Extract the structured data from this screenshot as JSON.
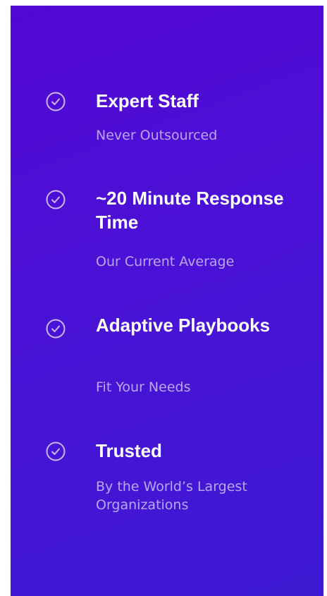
{
  "features": [
    {
      "icon": "check-circle-icon",
      "title": "Expert Staff",
      "subtitle": "Never Outsourced"
    },
    {
      "icon": "check-circle-icon",
      "title": "~20 Minute Response Time",
      "subtitle": "Our Current Average"
    },
    {
      "icon": "check-circle-icon",
      "title": "Adaptive Playbooks",
      "subtitle": "Fit Your Needs"
    },
    {
      "icon": "check-circle-icon",
      "title": "Trusted",
      "subtitle": "By the World’s Largest Organizations"
    }
  ],
  "colors": {
    "panel_top": "#5308d3",
    "panel_bottom": "#3e1ad3",
    "title": "#ffffff",
    "subtitle": "#b9a7f0"
  }
}
